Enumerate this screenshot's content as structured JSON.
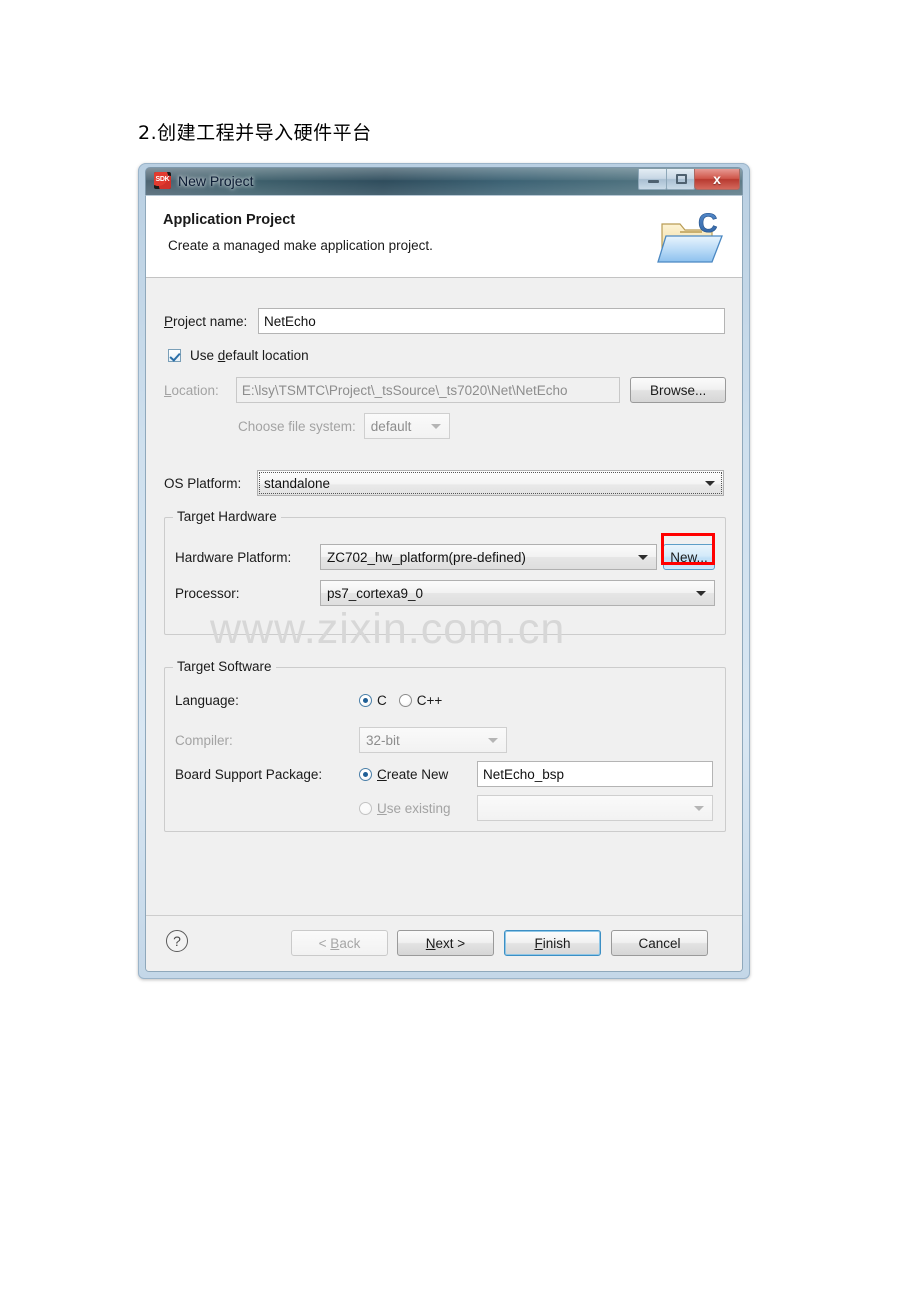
{
  "document": {
    "heading": "2.创建工程并导入硬件平台"
  },
  "window": {
    "title": "New Project",
    "app_icon_label": "SDK",
    "controls": {
      "minimize": "–",
      "maximize": "□",
      "close": "x"
    }
  },
  "header": {
    "title": "Application Project",
    "subtitle": "Create a managed make application project.",
    "icon": "c-project-folder-icon"
  },
  "form": {
    "project_name": {
      "label": "Project name:",
      "value": "NetEcho"
    },
    "use_default_location": {
      "label": "Use default location",
      "checked": true
    },
    "location": {
      "label": "Location:",
      "value": "E:\\lsy\\TSMTC\\Project\\_tsSource\\_ts7020\\Net\\NetEcho",
      "browse_label": "Browse...",
      "enabled": false
    },
    "file_system": {
      "label": "Choose file system:",
      "value": "default",
      "enabled": false
    },
    "os_platform": {
      "label": "OS Platform:",
      "value": "standalone"
    },
    "target_hardware": {
      "title": "Target Hardware",
      "hardware_platform": {
        "label": "Hardware Platform:",
        "value": "ZC702_hw_platform(pre-defined)"
      },
      "new_button": "New...",
      "processor": {
        "label": "Processor:",
        "value": "ps7_cortexa9_0"
      }
    },
    "target_software": {
      "title": "Target Software",
      "language": {
        "label": "Language:",
        "options": [
          "C",
          "C++"
        ],
        "selected": "C"
      },
      "compiler": {
        "label": "Compiler:",
        "value": "32-bit",
        "enabled": false
      },
      "bsp": {
        "label": "Board Support Package:",
        "create_new_label": "Create New",
        "create_new_value": "NetEcho_bsp",
        "use_existing_label": "Use existing",
        "use_existing_value": "",
        "selected": "Create New"
      }
    }
  },
  "buttons": {
    "help": "?",
    "back": "< Back",
    "next": "Next >",
    "finish": "Finish",
    "cancel": "Cancel"
  },
  "watermark": "www.zixin.com.cn",
  "colors": {
    "accent": "#3c8fc4",
    "annotation": "#ff0000",
    "titlebar": "#2e4c5c"
  }
}
